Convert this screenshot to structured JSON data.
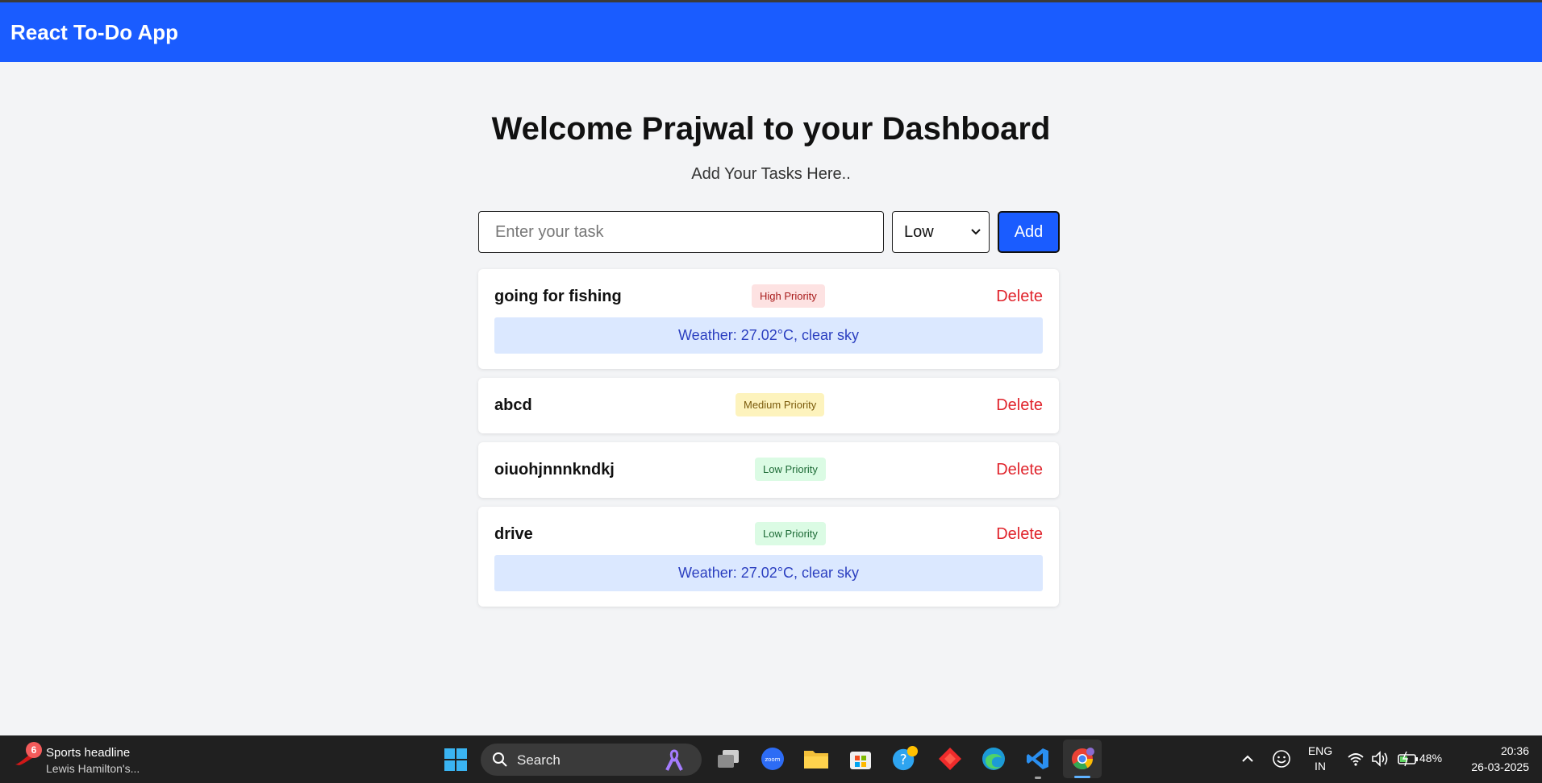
{
  "navbar": {
    "brand": "React To-Do App"
  },
  "dashboard": {
    "title": "Welcome Prajwal to your Dashboard",
    "subtitle": "Add Your Tasks Here.."
  },
  "form": {
    "task_placeholder": "Enter your task",
    "task_value": "",
    "priority_selected": "Low",
    "add_label": "Add"
  },
  "tasks": [
    {
      "name": "going for fishing",
      "priority": "High Priority",
      "level": "high",
      "delete_label": "Delete",
      "weather": "Weather: 27.02°C, clear sky"
    },
    {
      "name": "abcd",
      "priority": "Medium Priority",
      "level": "medium",
      "delete_label": "Delete",
      "weather": ""
    },
    {
      "name": "oiuohjnnnkndkj",
      "priority": "Low Priority",
      "level": "low",
      "delete_label": "Delete",
      "weather": ""
    },
    {
      "name": "drive",
      "priority": "Low Priority",
      "level": "low",
      "delete_label": "Delete",
      "weather": "Weather: 27.02°C, clear sky"
    }
  ],
  "colors": {
    "accent": "#1a5cff",
    "delete": "#e0242c",
    "weather_bg": "#dbe8ff",
    "weather_text": "#2b3fc0"
  },
  "taskbar": {
    "news": {
      "badge": "6",
      "title": "Sports headline",
      "subtitle": "Lewis Hamilton's..."
    },
    "search_label": "Search",
    "apps": [
      "task-view-icon",
      "zoom-icon",
      "file-explorer-icon",
      "microsoft-store-icon",
      "help-icon",
      "anydesk-icon",
      "edge-icon",
      "vscode-icon",
      "chrome-icon"
    ],
    "zoom_label": "zoom",
    "tray": {
      "lang_line1": "ENG",
      "lang_line2": "IN",
      "battery": "48%",
      "time": "20:36",
      "date": "26-03-2025"
    }
  }
}
